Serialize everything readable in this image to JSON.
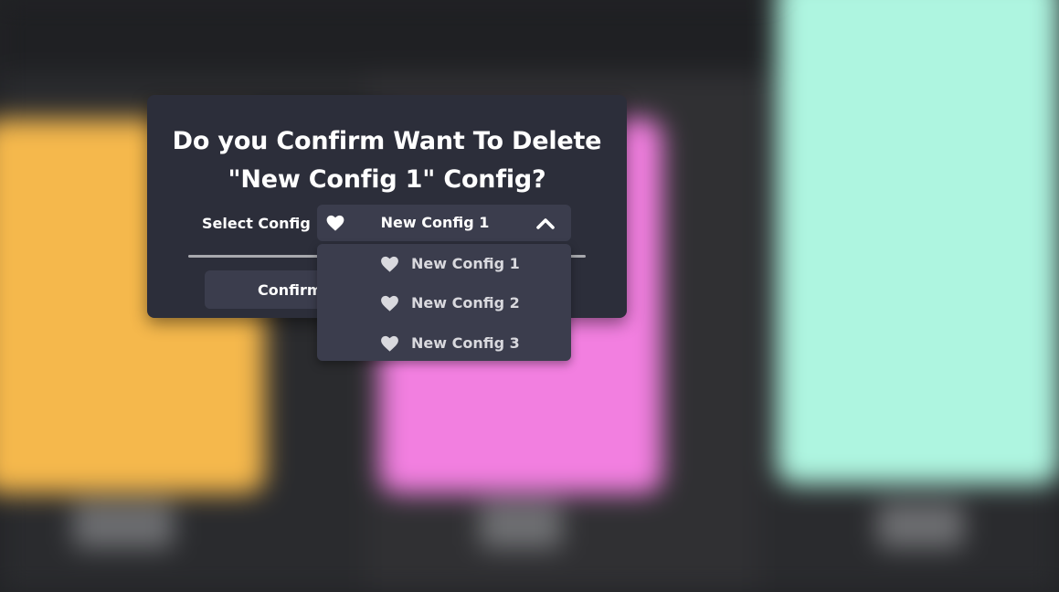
{
  "dialog": {
    "title_line1": "Do you Confirm Want To Delete",
    "title_line2": "\"New Config 1\" Config?",
    "select_label": "Select Config :",
    "selected_value": "New Config 1",
    "confirm_label": "Confirm"
  },
  "dropdown": {
    "expanded": true,
    "options": [
      {
        "label": "New Config 1",
        "icon": "heart-icon"
      },
      {
        "label": "New Config 2",
        "icon": "heart-icon"
      },
      {
        "label": "New Config 3",
        "icon": "heart-icon"
      }
    ]
  },
  "icons": {
    "selected_icon": "heart-icon",
    "toggle_icon": "chevron-up-icon"
  },
  "colors": {
    "dialog_bg": "#2c2e3a",
    "control_bg": "#3b3d4d",
    "text": "#ffffff",
    "card_orange": "#f5b84c",
    "card_pink": "#f27fe0",
    "card_mint": "#aef5e0"
  }
}
